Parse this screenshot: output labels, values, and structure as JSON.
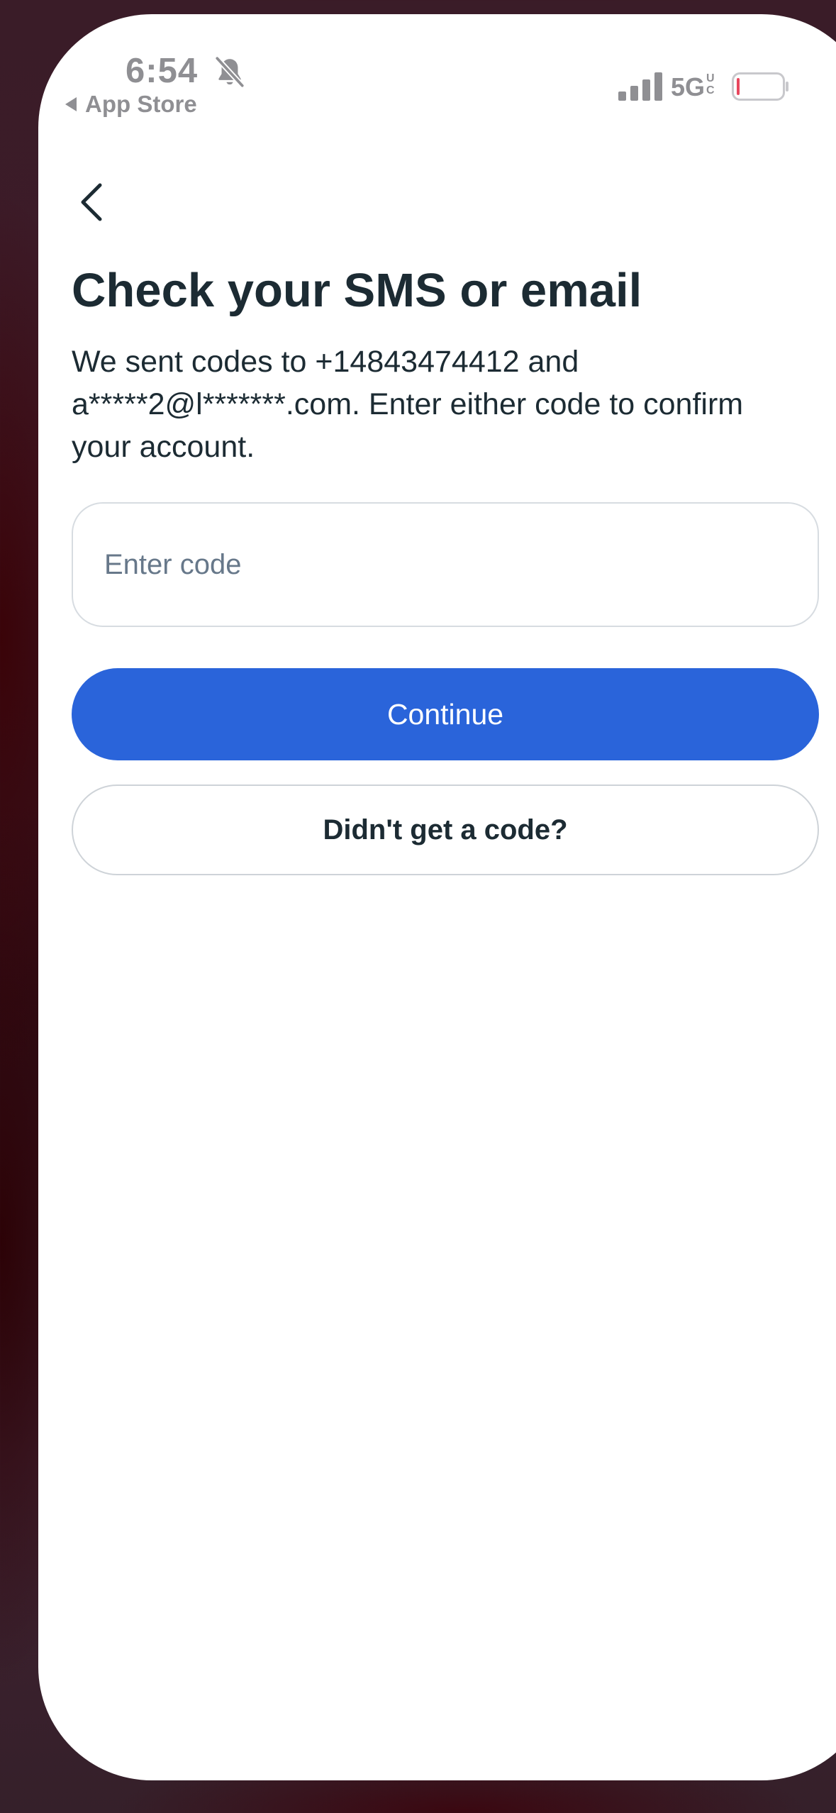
{
  "status_bar": {
    "time": "6:54",
    "back_app_label": "App Store",
    "network": "5G",
    "network_sup_top": "U",
    "network_sup_bottom": "C",
    "icons": [
      "bell-slash-icon",
      "cellular-signal-icon",
      "battery-icon"
    ]
  },
  "nav": {
    "back_icon": "chevron-left-icon"
  },
  "main": {
    "title": "Check your SMS or email",
    "description": "We sent codes to +14843474412 and a*****2@l*******.com. Enter either code to confirm your account.",
    "code_input": {
      "value": "",
      "placeholder": "Enter code"
    },
    "continue_label": "Continue",
    "no_code_label": "Didn't get a code?"
  },
  "colors": {
    "primary_button": "#2a64da",
    "text": "#1c2b33",
    "placeholder": "#67788a",
    "status_gray": "#8f8f93",
    "battery_low": "#e8475e"
  }
}
